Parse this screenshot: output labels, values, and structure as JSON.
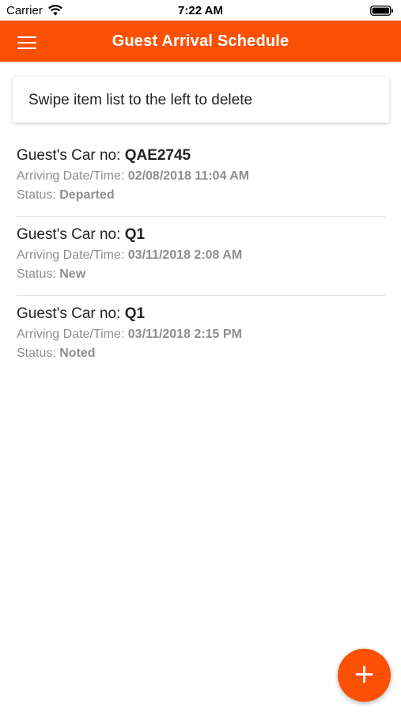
{
  "status_bar": {
    "carrier": "Carrier",
    "time": "7:22 AM"
  },
  "app_bar": {
    "title": "Guest Arrival Schedule",
    "menu_icon": "hamburger-menu-icon",
    "color": "#fc5105"
  },
  "hint": {
    "text": "Swipe item list to the left to delete"
  },
  "list": {
    "car_label": "Guest's Car no: ",
    "date_label": "Arriving Date/Time: ",
    "status_label": "Status: ",
    "items": [
      {
        "car_no": "QAE2745",
        "arriving": "02/08/2018 11:04 AM",
        "status": "Departed"
      },
      {
        "car_no": "Q1",
        "arriving": "03/11/2018 2:08 AM",
        "status": "New"
      },
      {
        "car_no": "Q1",
        "arriving": "03/11/2018 2:15 PM",
        "status": "Noted"
      }
    ]
  },
  "fab": {
    "label": "+",
    "icon": "plus-icon"
  }
}
